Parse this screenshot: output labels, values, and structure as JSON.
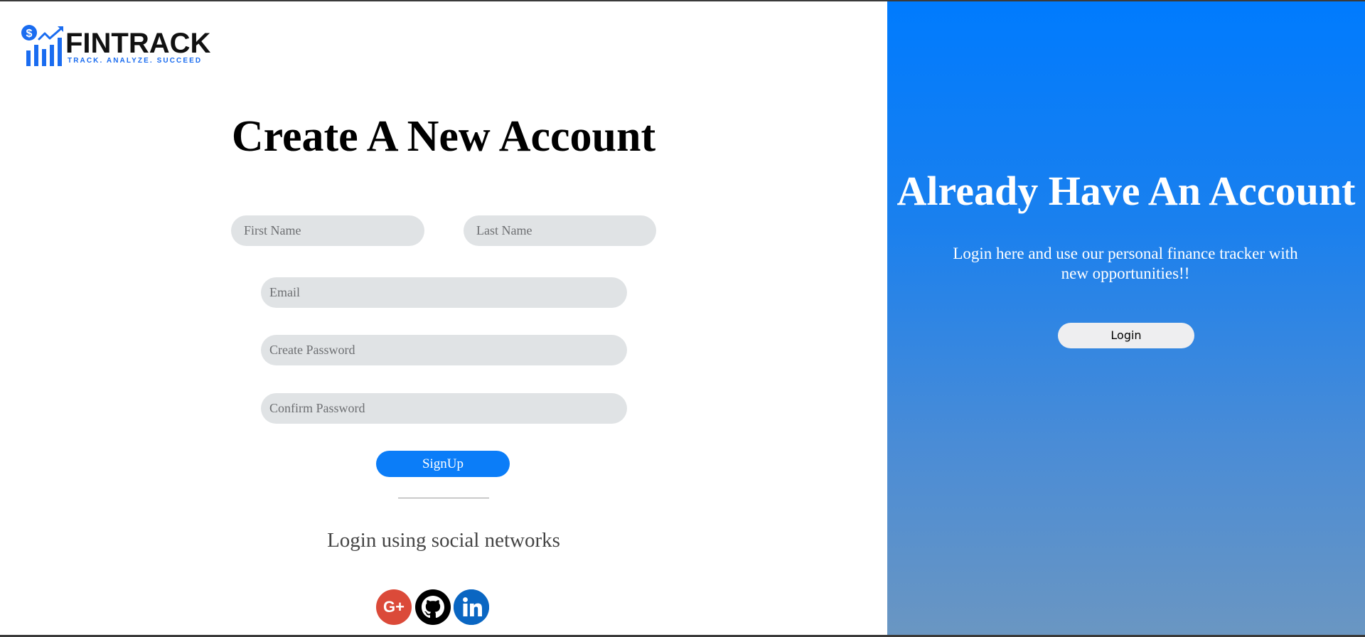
{
  "brand": {
    "name": "FINTRACK",
    "tagline": "TRACK. ANALYZE. SUCCEED",
    "logo_icon": "dollar-chart-icon",
    "colors": {
      "mark": "#1a6cf0",
      "text": "#111111"
    }
  },
  "signup": {
    "title": "Create A New Account",
    "fields": {
      "first_name": {
        "placeholder": "First Name",
        "value": ""
      },
      "last_name": {
        "placeholder": "Last Name",
        "value": ""
      },
      "email": {
        "placeholder": "Email",
        "value": ""
      },
      "create_password": {
        "placeholder": "Create Password",
        "value": ""
      },
      "confirm_password": {
        "placeholder": "Confirm Password",
        "value": ""
      }
    },
    "submit_label": "SignUp",
    "social_heading": "Login using social networks",
    "social": [
      {
        "name": "Google Plus",
        "icon": "google-plus-icon",
        "label": "G+",
        "color": "#db4a39"
      },
      {
        "name": "GitHub",
        "icon": "github-icon",
        "color": "#000000"
      },
      {
        "name": "LinkedIn",
        "icon": "linkedin-icon",
        "color": "#0a66c2"
      }
    ],
    "colors": {
      "accent": "#0b7df8",
      "field_bg": "#e0e3e5"
    }
  },
  "login_panel": {
    "title": "Already Have An Account",
    "description": "Login here and use our personal finance tracker with new opportunities!!",
    "button_label": "Login",
    "colors": {
      "gradient_top": "#007bfe",
      "gradient_bottom": "#6a96c2"
    }
  }
}
